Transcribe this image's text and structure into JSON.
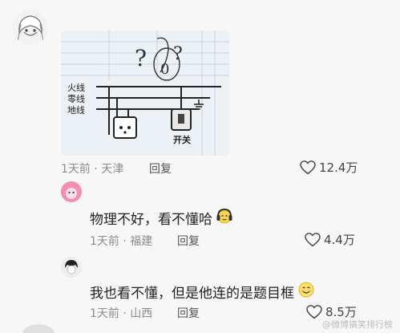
{
  "post": {
    "diagram": {
      "labels": {
        "live": "火线",
        "neutral": "零线",
        "ground": "地线",
        "switch": "开关"
      },
      "question_marks": "?",
      "zero_mark": "0"
    },
    "meta": {
      "time": "1天前",
      "location": "天津"
    },
    "reply_label": "回复",
    "likes": "12.4万"
  },
  "comments": [
    {
      "text": "物理不好，看不懂哈",
      "emoji": "headphone-face-emoji",
      "meta": {
        "time": "1天前",
        "location": "福建"
      },
      "reply_label": "回复",
      "likes": "4.4万"
    },
    {
      "text": "我也看不懂，但是他连的是题目框",
      "emoji": "smiling-face-emoji",
      "meta": {
        "time": "1天前",
        "location": "山西"
      },
      "reply_label": "回复",
      "likes": "8.5万"
    }
  ],
  "watermark": "@微博搞笑排行榜",
  "colors": {
    "accent_pink": "#f48fb1",
    "meta_gray": "#8c8c8c",
    "card_bg": "#ecf1f6"
  },
  "icons": [
    "avatar",
    "heart-outline-icon",
    "headphone-face-emoji",
    "smiling-face-emoji"
  ]
}
